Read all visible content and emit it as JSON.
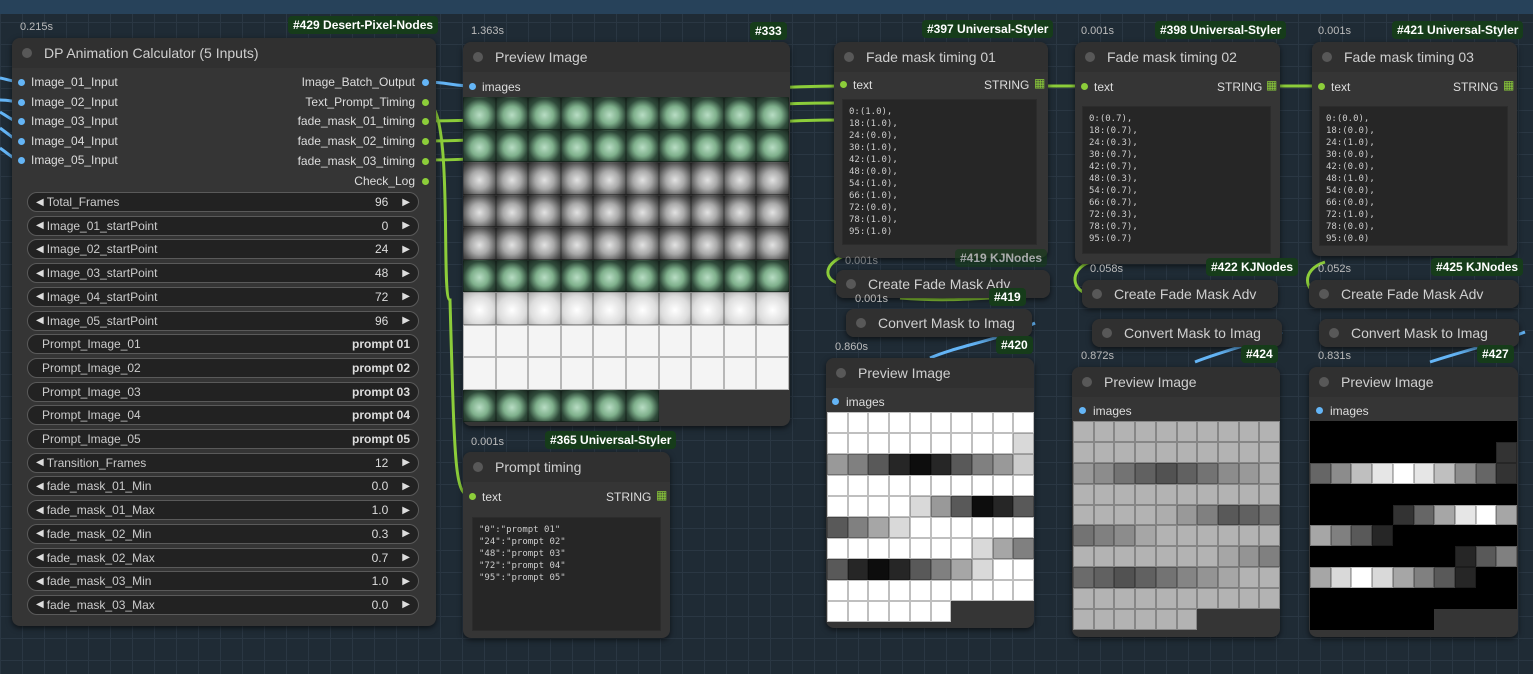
{
  "n429": {
    "time": "0.215s",
    "badge": "#429 Desert-Pixel-Nodes",
    "title": "DP Animation Calculator (5 Inputs)",
    "inputs": [
      "Image_01_Input",
      "Image_02_Input",
      "Image_03_Input",
      "Image_04_Input",
      "Image_05_Input"
    ],
    "outputs": [
      "Image_Batch_Output",
      "Text_Prompt_Timing",
      "fade_mask_01_timing",
      "fade_mask_02_timing",
      "fade_mask_03_timing",
      "Check_Log"
    ],
    "widgets": [
      {
        "label": "Total_Frames",
        "value": "96",
        "kind": "num"
      },
      {
        "label": "Image_01_startPoint",
        "value": "0",
        "kind": "num"
      },
      {
        "label": "Image_02_startPoint",
        "value": "24",
        "kind": "num"
      },
      {
        "label": "Image_03_startPoint",
        "value": "48",
        "kind": "num"
      },
      {
        "label": "Image_04_startPoint",
        "value": "72",
        "kind": "num"
      },
      {
        "label": "Image_05_startPoint",
        "value": "96",
        "kind": "num"
      },
      {
        "label": "Prompt_Image_01",
        "value": "prompt 01",
        "kind": "text"
      },
      {
        "label": "Prompt_Image_02",
        "value": "prompt 02",
        "kind": "text"
      },
      {
        "label": "Prompt_Image_03",
        "value": "prompt 03",
        "kind": "text"
      },
      {
        "label": "Prompt_Image_04",
        "value": "prompt 04",
        "kind": "text"
      },
      {
        "label": "Prompt_Image_05",
        "value": "prompt 05",
        "kind": "text"
      },
      {
        "label": "Transition_Frames",
        "value": "12",
        "kind": "num"
      },
      {
        "label": "fade_mask_01_Min",
        "value": "0.0",
        "kind": "num"
      },
      {
        "label": "fade_mask_01_Max",
        "value": "1.0",
        "kind": "num"
      },
      {
        "label": "fade_mask_02_Min",
        "value": "0.3",
        "kind": "num"
      },
      {
        "label": "fade_mask_02_Max",
        "value": "0.7",
        "kind": "num"
      },
      {
        "label": "fade_mask_03_Min",
        "value": "1.0",
        "kind": "num"
      },
      {
        "label": "fade_mask_03_Max",
        "value": "0.0",
        "kind": "num"
      }
    ]
  },
  "n333": {
    "time": "1.363s",
    "badge": "#333",
    "title": "Preview Image",
    "input": "images"
  },
  "n365": {
    "time": "0.001s",
    "badge": "#365 Universal-Styler",
    "title": "Prompt timing",
    "input": "text",
    "type": "STRING",
    "text": "\"0\":\"prompt 01\"\n\"24\":\"prompt 02\"\n\"48\":\"prompt 03\"\n\"72\":\"prompt 04\"\n\"95\":\"prompt 05\""
  },
  "n397": {
    "badge": "#397 Universal-Styler",
    "title": "Fade mask timing 01",
    "input": "text",
    "type": "STRING",
    "text": "0:(1.0),\n18:(1.0),\n24:(0.0),\n30:(1.0),\n42:(1.0),\n48:(0.0),\n54:(1.0),\n66:(1.0),\n72:(0.0),\n78:(1.0),\n95:(1.0)"
  },
  "n398": {
    "time": "0.001s",
    "badge": "#398 Universal-Styler",
    "title": "Fade mask timing 02",
    "input": "text",
    "type": "STRING",
    "text": "0:(0.7),\n18:(0.7),\n24:(0.3),\n30:(0.7),\n42:(0.7),\n48:(0.3),\n54:(0.7),\n66:(0.7),\n72:(0.3),\n78:(0.7),\n95:(0.7)"
  },
  "n421": {
    "time": "0.001s",
    "badge": "#421 Universal-Styler",
    "title": "Fade mask timing 03",
    "input": "text",
    "type": "STRING",
    "text": "0:(0.0),\n18:(0.0),\n24:(1.0),\n30:(0.0),\n42:(0.0),\n48:(1.0),\n54:(0.0),\n66:(0.0),\n72:(1.0),\n78:(0.0),\n95:(0.0)"
  },
  "n419": {
    "time": "0.001s",
    "badge": "#419",
    "title": "Convert Mask to Imag",
    "fade_title": "Create Fade Mask Adv",
    "fade_time": "0.001s",
    "fade_badge": "#419 KJNodes"
  },
  "n422": {
    "time": "0.058s",
    "badge": "#422 KJNodes",
    "title": "Create Fade Mask Adv",
    "convert_title": "Convert Mask to Imag"
  },
  "n425": {
    "time": "0.052s",
    "badge": "#425 KJNodes",
    "title": "Create Fade Mask Adv",
    "convert_title": "Convert Mask to Imag"
  },
  "n420": {
    "time": "0.860s",
    "badge": "#420",
    "title": "Preview Image",
    "input": "images"
  },
  "n424": {
    "time": "0.872s",
    "badge": "#424",
    "title": "Preview Image",
    "input": "images"
  },
  "n427": {
    "time": "0.831s",
    "badge": "#427",
    "title": "Preview Image",
    "input": "images"
  },
  "mask420": [
    [
      1,
      1,
      1,
      1,
      1,
      1,
      1,
      1,
      1,
      1
    ],
    [
      1,
      1,
      1,
      1,
      1,
      1,
      1,
      1,
      1,
      0.85
    ],
    [
      0.6,
      0.5,
      0.35,
      0.15,
      0.05,
      0.15,
      0.35,
      0.5,
      0.6,
      0.8
    ],
    [
      1,
      1,
      1,
      1,
      1,
      1,
      1,
      1,
      1,
      1
    ],
    [
      1,
      1,
      1,
      1,
      0.85,
      0.6,
      0.35,
      0.05,
      0.15,
      0.35
    ],
    [
      0.35,
      0.5,
      0.65,
      0.85,
      1,
      1,
      1,
      1,
      1,
      1
    ],
    [
      1,
      1,
      1,
      1,
      1,
      1,
      1,
      0.85,
      0.65,
      0.5
    ],
    [
      0.35,
      0.15,
      0.05,
      0.15,
      0.35,
      0.5,
      0.65,
      0.85,
      1,
      1
    ],
    [
      1,
      1,
      1,
      1,
      1,
      1,
      1,
      1,
      1,
      1
    ],
    [
      1,
      1,
      1,
      1,
      1,
      1,
      null,
      null,
      null,
      null
    ]
  ],
  "mask424": [
    [
      0.7,
      0.7,
      0.7,
      0.7,
      0.7,
      0.7,
      0.7,
      0.7,
      0.7,
      0.7
    ],
    [
      0.7,
      0.7,
      0.7,
      0.7,
      0.7,
      0.7,
      0.7,
      0.7,
      0.7,
      0.7
    ],
    [
      0.6,
      0.55,
      0.45,
      0.38,
      0.32,
      0.38,
      0.45,
      0.55,
      0.6,
      0.68
    ],
    [
      0.7,
      0.7,
      0.7,
      0.7,
      0.7,
      0.7,
      0.7,
      0.7,
      0.7,
      0.7
    ],
    [
      0.7,
      0.7,
      0.7,
      0.7,
      0.68,
      0.6,
      0.5,
      0.35,
      0.38,
      0.45
    ],
    [
      0.45,
      0.5,
      0.55,
      0.65,
      0.7,
      0.7,
      0.7,
      0.7,
      0.7,
      0.7
    ],
    [
      0.7,
      0.7,
      0.7,
      0.7,
      0.7,
      0.7,
      0.7,
      0.65,
      0.58,
      0.5
    ],
    [
      0.42,
      0.38,
      0.32,
      0.38,
      0.45,
      0.52,
      0.58,
      0.65,
      0.7,
      0.7
    ],
    [
      0.7,
      0.7,
      0.7,
      0.7,
      0.7,
      0.7,
      0.7,
      0.7,
      0.7,
      0.7
    ],
    [
      0.7,
      0.7,
      0.7,
      0.7,
      0.7,
      0.7,
      null,
      null,
      null,
      null
    ]
  ],
  "mask427": [
    [
      0,
      0,
      0,
      0,
      0,
      0,
      0,
      0,
      0,
      0
    ],
    [
      0,
      0,
      0,
      0,
      0,
      0,
      0,
      0,
      0,
      0.2
    ],
    [
      0.4,
      0.55,
      0.75,
      0.9,
      1,
      0.9,
      0.75,
      0.55,
      0.4,
      0.2
    ],
    [
      0,
      0,
      0,
      0,
      0,
      0,
      0,
      0,
      0,
      0
    ],
    [
      0,
      0,
      0,
      0,
      0.2,
      0.4,
      0.65,
      0.9,
      1,
      0.65
    ],
    [
      0.65,
      0.5,
      0.35,
      0.15,
      0,
      0,
      0,
      0,
      0,
      0
    ],
    [
      0,
      0,
      0,
      0,
      0,
      0,
      0,
      0.15,
      0.35,
      0.5
    ],
    [
      0.65,
      0.85,
      1,
      0.85,
      0.65,
      0.5,
      0.35,
      0.15,
      0,
      0
    ],
    [
      0,
      0,
      0,
      0,
      0,
      0,
      0,
      0,
      0,
      0
    ],
    [
      0,
      0,
      0,
      0,
      0,
      0,
      null,
      null,
      null,
      null
    ]
  ]
}
